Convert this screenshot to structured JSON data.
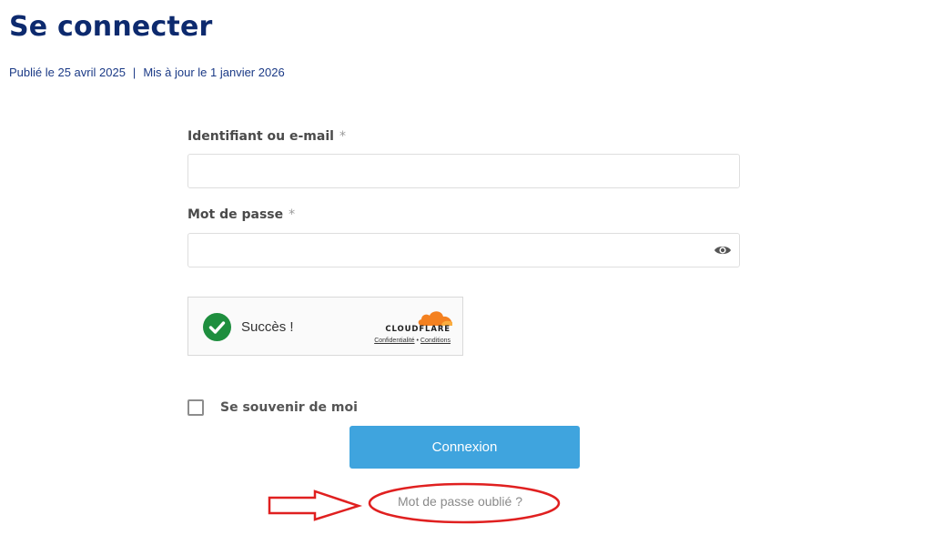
{
  "page": {
    "title": "Se connecter",
    "published": "Publié le 25 avril 2025",
    "separator": "|",
    "updated": "Mis à jour le 1 janvier 2026"
  },
  "form": {
    "username": {
      "label": "Identifiant ou e-mail",
      "required_mark": "*",
      "value": "",
      "placeholder": ""
    },
    "password": {
      "label": "Mot de passe",
      "required_mark": "*",
      "value": "",
      "placeholder": ""
    },
    "remember_label": "Se souvenir de moi",
    "remember_checked": false,
    "submit_label": "Connexion",
    "forgot_label": "Mot de passe oublié ?"
  },
  "captcha": {
    "status": "Succès !",
    "brand": "CLOUDFLARE",
    "privacy_label": "Confidentialité",
    "dot": "•",
    "terms_label": "Conditions",
    "check_color": "#1e8e3e",
    "cloud_color": "#f48120"
  },
  "annotation": {
    "arrow_icon": "right-arrow-icon",
    "circle_icon": "ellipse-highlight-icon",
    "color": "#e02020"
  },
  "icons": {
    "password_toggle": "eye-icon",
    "captcha_success": "check-circle-icon",
    "captcha_logo": "cloudflare-cloud-icon"
  },
  "colors": {
    "title": "#0d2a6e",
    "meta": "#1b3a86",
    "button_bg": "#3fa4de",
    "button_text": "#ffffff"
  }
}
